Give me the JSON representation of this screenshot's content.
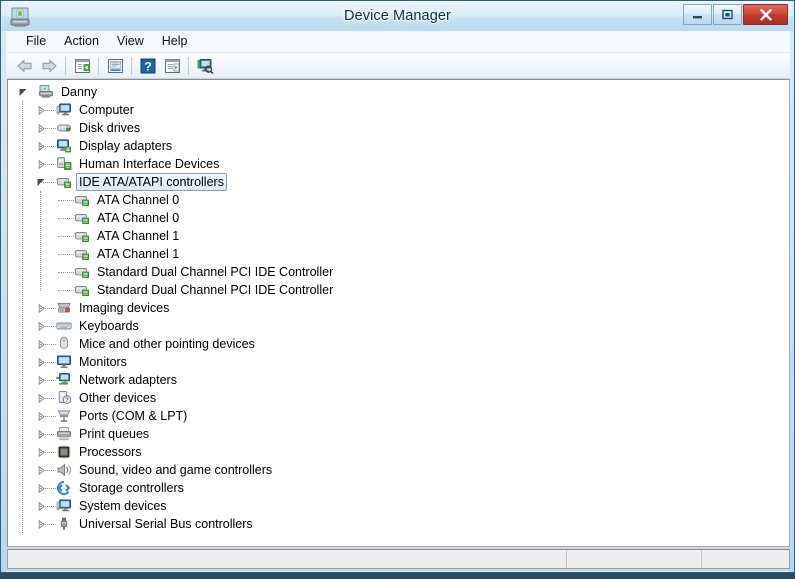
{
  "window": {
    "title": "Device Manager",
    "app_icon": "device-manager-icon",
    "minimize_label": "Minimize",
    "maximize_label": "Maximize",
    "close_label": "Close"
  },
  "menubar": {
    "items": [
      {
        "label": "File",
        "name": "menu-file"
      },
      {
        "label": "Action",
        "name": "menu-action"
      },
      {
        "label": "View",
        "name": "menu-view"
      },
      {
        "label": "Help",
        "name": "menu-help"
      }
    ]
  },
  "toolbar": {
    "buttons": [
      {
        "icon": "back-arrow-icon",
        "tooltip": "Back"
      },
      {
        "icon": "forward-arrow-icon",
        "tooltip": "Forward"
      },
      {
        "icon": "show-hide-console-tree-icon",
        "tooltip": "Show/Hide Console Tree"
      },
      {
        "icon": "properties-icon",
        "tooltip": "Properties"
      },
      {
        "icon": "help-question-icon",
        "tooltip": "Help"
      },
      {
        "icon": "show-hide-action-pane-icon",
        "tooltip": "Show/Hide Action Pane"
      },
      {
        "icon": "scan-for-hardware-changes-icon",
        "tooltip": "Scan for hardware changes"
      }
    ]
  },
  "tree": {
    "root": {
      "label": "Danny",
      "icon": "computer-root-icon",
      "expanded": true,
      "level": 0
    },
    "nodes": [
      {
        "label": "Computer",
        "icon": "computer-icon",
        "level": 1,
        "expandable": true,
        "expanded": false,
        "selected": false
      },
      {
        "label": "Disk drives",
        "icon": "disk-drive-icon",
        "level": 1,
        "expandable": true,
        "expanded": false,
        "selected": false
      },
      {
        "label": "Display adapters",
        "icon": "display-adapter-icon",
        "level": 1,
        "expandable": true,
        "expanded": false,
        "selected": false
      },
      {
        "label": "Human Interface Devices",
        "icon": "hid-icon",
        "level": 1,
        "expandable": true,
        "expanded": false,
        "selected": false
      },
      {
        "label": "IDE ATA/ATAPI controllers",
        "icon": "ide-controller-icon",
        "level": 1,
        "expandable": true,
        "expanded": true,
        "selected": true
      },
      {
        "label": "ATA Channel 0",
        "icon": "ata-channel-icon",
        "level": 2,
        "expandable": false,
        "expanded": false,
        "selected": false
      },
      {
        "label": "ATA Channel 0",
        "icon": "ata-channel-icon",
        "level": 2,
        "expandable": false,
        "expanded": false,
        "selected": false
      },
      {
        "label": "ATA Channel 1",
        "icon": "ata-channel-icon",
        "level": 2,
        "expandable": false,
        "expanded": false,
        "selected": false
      },
      {
        "label": "ATA Channel 1",
        "icon": "ata-channel-icon",
        "level": 2,
        "expandable": false,
        "expanded": false,
        "selected": false
      },
      {
        "label": "Standard Dual Channel PCI IDE Controller",
        "icon": "ata-channel-icon",
        "level": 2,
        "expandable": false,
        "expanded": false,
        "selected": false
      },
      {
        "label": "Standard Dual Channel PCI IDE Controller",
        "icon": "ata-channel-icon",
        "level": 2,
        "expandable": false,
        "expanded": false,
        "selected": false
      },
      {
        "label": "Imaging devices",
        "icon": "imaging-device-icon",
        "level": 1,
        "expandable": true,
        "expanded": false,
        "selected": false
      },
      {
        "label": "Keyboards",
        "icon": "keyboard-icon",
        "level": 1,
        "expandable": true,
        "expanded": false,
        "selected": false
      },
      {
        "label": "Mice and other pointing devices",
        "icon": "mouse-icon",
        "level": 1,
        "expandable": true,
        "expanded": false,
        "selected": false
      },
      {
        "label": "Monitors",
        "icon": "monitor-icon",
        "level": 1,
        "expandable": true,
        "expanded": false,
        "selected": false
      },
      {
        "label": "Network adapters",
        "icon": "network-adapter-icon",
        "level": 1,
        "expandable": true,
        "expanded": false,
        "selected": false
      },
      {
        "label": "Other devices",
        "icon": "other-device-icon",
        "level": 1,
        "expandable": true,
        "expanded": false,
        "selected": false
      },
      {
        "label": "Ports (COM & LPT)",
        "icon": "port-icon",
        "level": 1,
        "expandable": true,
        "expanded": false,
        "selected": false
      },
      {
        "label": "Print queues",
        "icon": "printer-icon",
        "level": 1,
        "expandable": true,
        "expanded": false,
        "selected": false
      },
      {
        "label": "Processors",
        "icon": "processor-icon",
        "level": 1,
        "expandable": true,
        "expanded": false,
        "selected": false
      },
      {
        "label": "Sound, video and game controllers",
        "icon": "sound-icon",
        "level": 1,
        "expandable": true,
        "expanded": false,
        "selected": false
      },
      {
        "label": "Storage controllers",
        "icon": "storage-controller-icon",
        "level": 1,
        "expandable": true,
        "expanded": false,
        "selected": false
      },
      {
        "label": "System devices",
        "icon": "system-device-icon",
        "level": 1,
        "expandable": true,
        "expanded": false,
        "selected": false
      },
      {
        "label": "Universal Serial Bus controllers",
        "icon": "usb-icon",
        "level": 1,
        "expandable": true,
        "expanded": false,
        "selected": false
      }
    ]
  },
  "statusbar": {
    "panel1": "",
    "panel2": "",
    "panel3": ""
  },
  "desktop": {
    "taskbar_sliver_text": ""
  },
  "colors": {
    "titlebar_accent": "#b9d9f0",
    "close_button": "#c13b2c",
    "selection_border": "#7da2c4",
    "window_border": "#2b5f86",
    "tree_background": "#ffffff"
  }
}
